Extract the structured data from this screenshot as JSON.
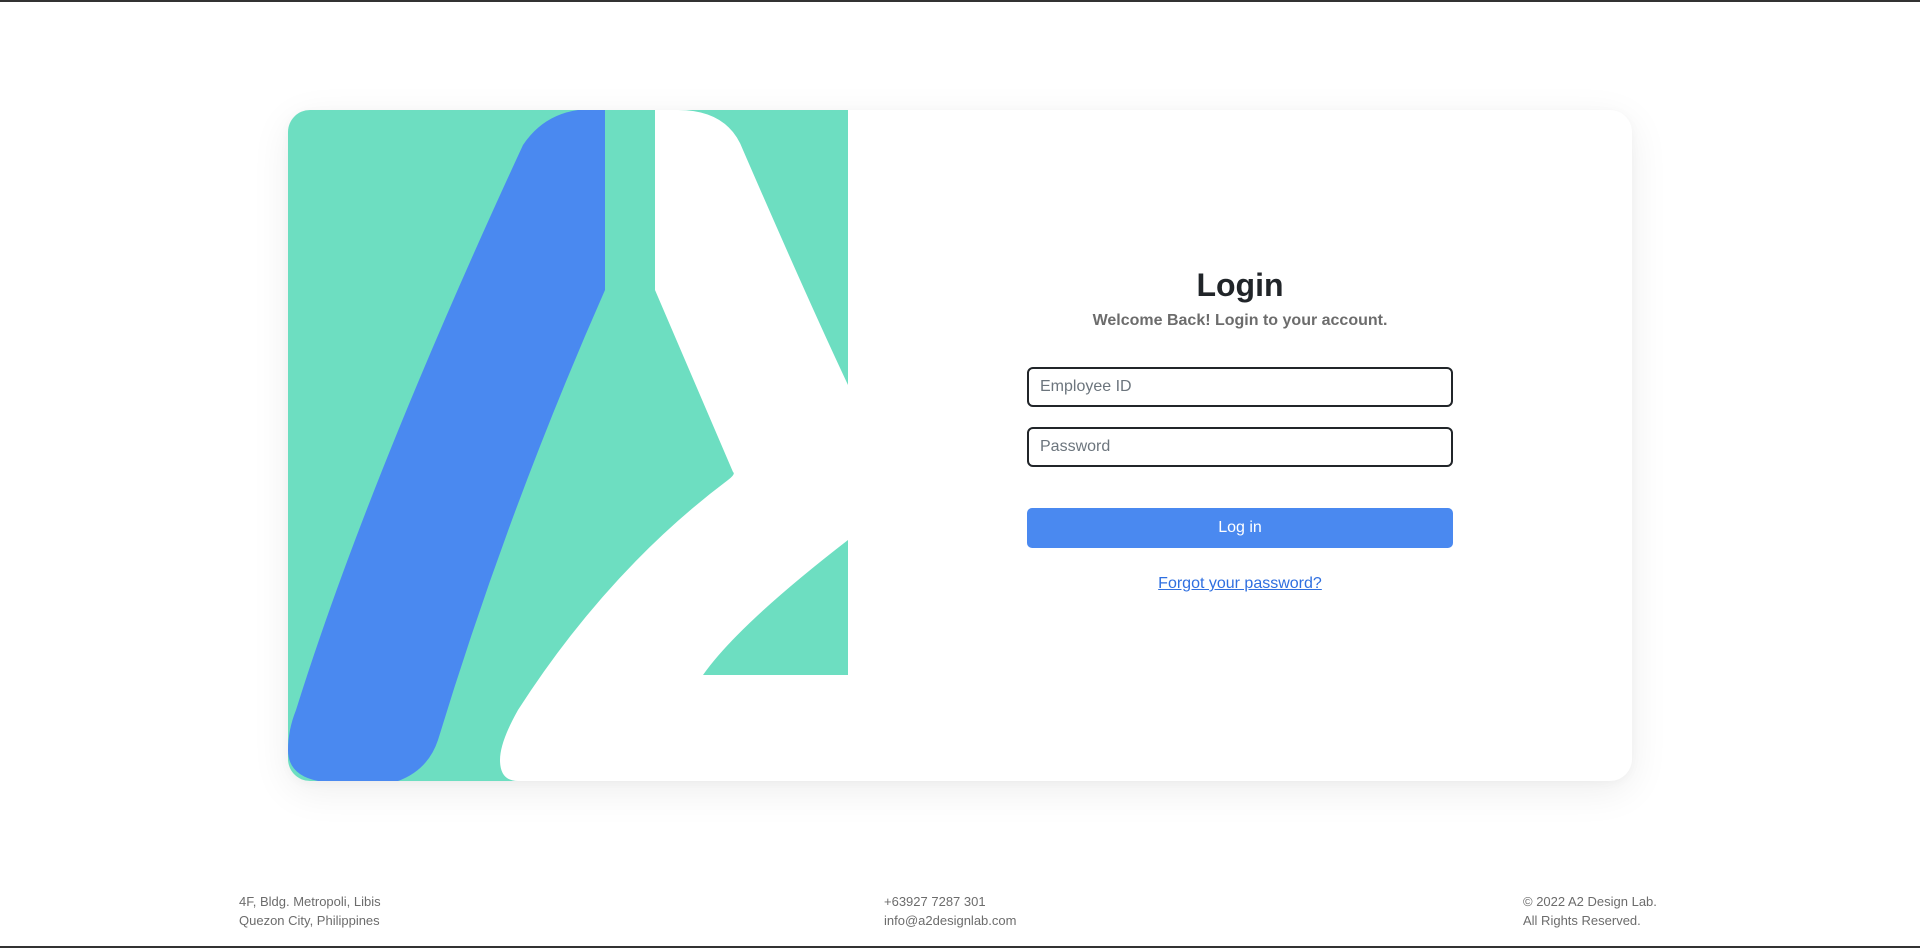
{
  "colors": {
    "teal": "#6ddec1",
    "blue": "#4a89f0",
    "white": "#ffffff",
    "link": "#2f6fe0"
  },
  "login": {
    "title": "Login",
    "subtitle": "Welcome Back! Login to your account.",
    "employee_id_placeholder": "Employee ID",
    "employee_id_value": "",
    "password_placeholder": "Password",
    "password_value": "",
    "login_button": "Log in",
    "forgot_link": "Forgot your password?"
  },
  "footer": {
    "address_line1": "4F, Bldg. Metropoli, Libis",
    "address_line2": "Quezon City, Philippines",
    "phone": "+63927 7287 301",
    "email": "info@a2designlab.com",
    "copyright": "© 2022 A2 Design Lab.",
    "rights": "All Rights Reserved."
  }
}
